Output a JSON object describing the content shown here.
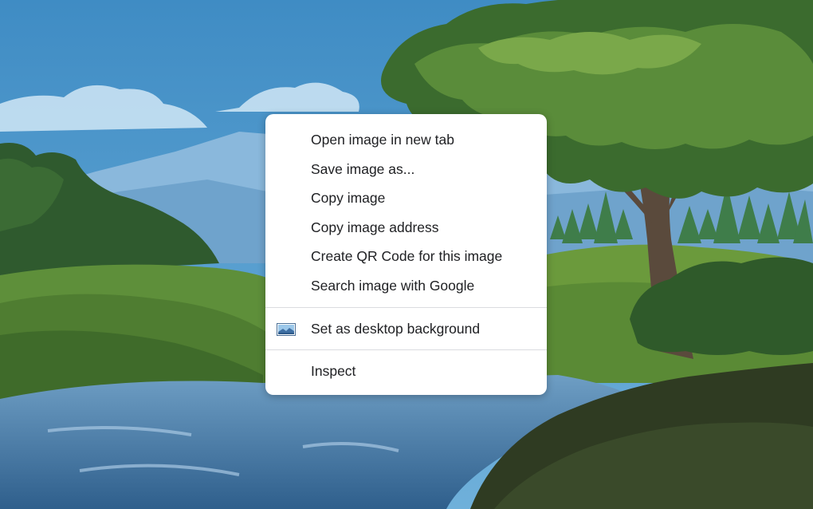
{
  "context_menu": {
    "items": [
      {
        "label": "Open image in new tab"
      },
      {
        "label": "Save image as..."
      },
      {
        "label": "Copy image"
      },
      {
        "label": "Copy image address"
      },
      {
        "label": "Create QR Code for this image"
      },
      {
        "label": "Search image with Google"
      }
    ],
    "desktop_item": {
      "label": "Set as desktop background",
      "icon": "desktop-background-icon"
    },
    "inspect_item": {
      "label": "Inspect"
    }
  },
  "colors": {
    "sky": "#4a95c9",
    "menu_bg": "#ffffff",
    "menu_text": "#202124",
    "separator": "#dadce0"
  }
}
